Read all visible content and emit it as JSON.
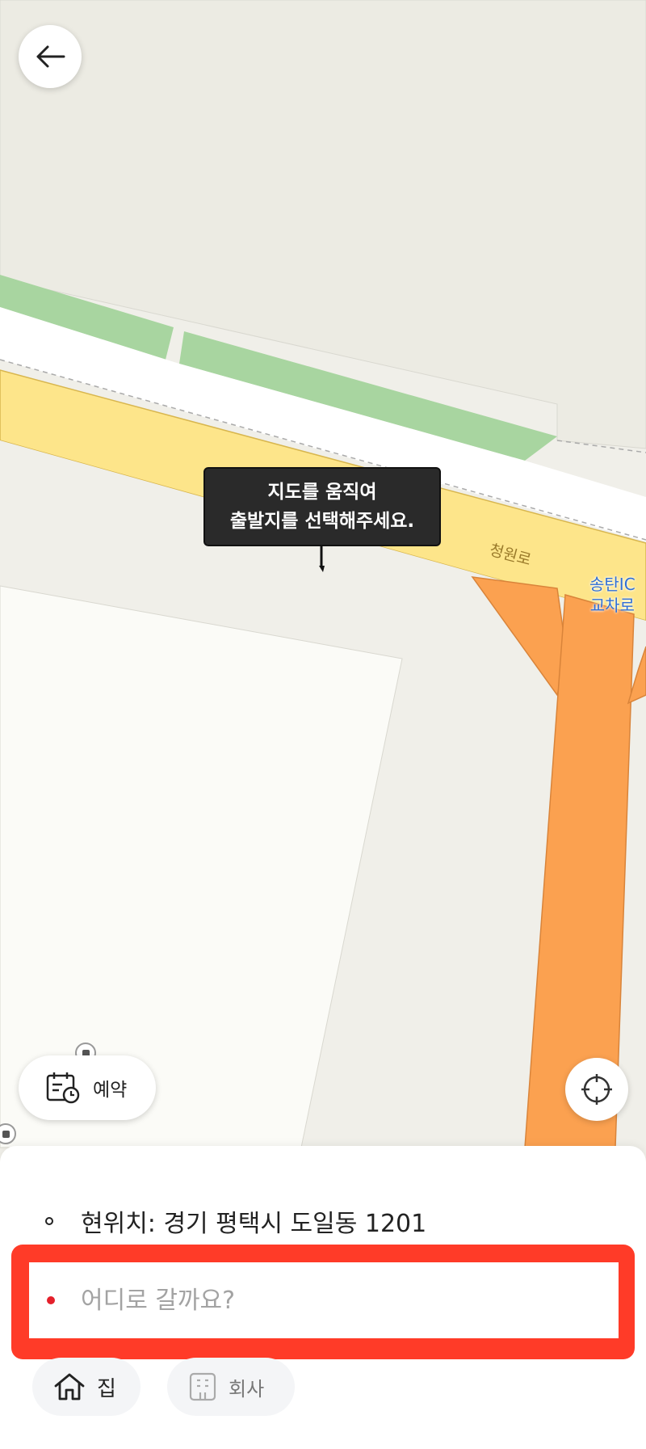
{
  "map": {
    "tooltip_line1": "지도를 움직여",
    "tooltip_line2": "출발지를 선택해주세요.",
    "road_label": "청원로",
    "ic_label_line1": "송탄IC",
    "ic_label_line2": "교차로"
  },
  "buttons": {
    "reserve_label": "예약"
  },
  "panel": {
    "current_location": "현위치: 경기 평택시 도일동 1201",
    "destination_placeholder": "어디로 갈까요?",
    "shortcuts": [
      {
        "label": "집",
        "icon": "home-icon"
      },
      {
        "label": "회사",
        "icon": "building-icon"
      }
    ]
  },
  "colors": {
    "highlight_border": "#ff3b28",
    "road_yellow": "#fde58a",
    "road_orange": "#fba150",
    "park_green": "#a8d5a0",
    "destination_dot": "#e4202b"
  }
}
